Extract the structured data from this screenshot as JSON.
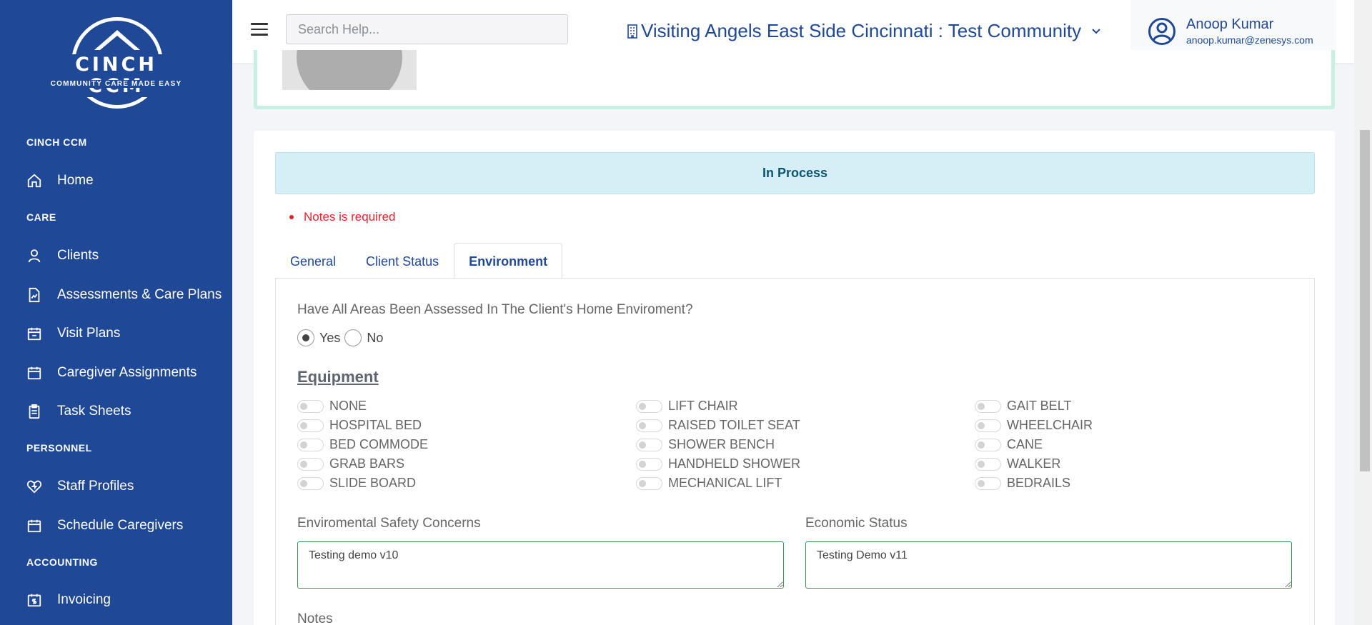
{
  "sidebar": {
    "brand": "CINCH CCM",
    "tagline": "COMMUNITY CARE MADE EASY",
    "sections": {
      "cinch": "CINCH CCM",
      "care": "CARE",
      "personnel": "PERSONNEL",
      "accounting": "ACCOUNTING"
    },
    "items": {
      "home": "Home",
      "clients": "Clients",
      "assessments": "Assessments & Care Plans",
      "visit_plans": "Visit Plans",
      "caregiver_assignments": "Caregiver Assignments",
      "task_sheets": "Task Sheets",
      "staff_profiles": "Staff Profiles",
      "schedule_caregivers": "Schedule Caregivers",
      "invoicing": "Invoicing"
    }
  },
  "header": {
    "search_placeholder": "Search Help...",
    "organization": "Visiting Angels East Side Cincinnati : Test Community",
    "user_name": "Anoop Kumar",
    "user_email": "anoop.kumar@zenesys.com"
  },
  "status_banner": "In Process",
  "error_message": "Notes is required",
  "tabs": [
    "General",
    "Client Status",
    "Environment"
  ],
  "environment": {
    "question": "Have All Areas Been Assessed In The Client's Home Enviroment?",
    "radio_yes": "Yes",
    "radio_no": "No",
    "selected": "Yes",
    "equipment_heading": "Equipment",
    "equipment_columns": [
      [
        "NONE",
        "HOSPITAL BED",
        "BED COMMODE",
        "GRAB BARS",
        "SLIDE BOARD"
      ],
      [
        "LIFT CHAIR",
        "RAISED TOILET SEAT",
        "SHOWER BENCH",
        "HANDHELD SHOWER",
        "MECHANICAL LIFT"
      ],
      [
        "GAIT BELT",
        "WHEELCHAIR",
        "CANE",
        "WALKER",
        "BEDRAILS"
      ]
    ],
    "safety_label": "Enviromental Safety Concerns",
    "safety_value": "Testing demo v10",
    "economic_label": "Economic Status",
    "economic_value": "Testing Demo v11",
    "notes_label": "Notes"
  },
  "colors": {
    "sidebar_bg": "#1f4896",
    "accent": "#1f4896",
    "banner_bg": "#d6eef6",
    "error": "#e3232f"
  }
}
